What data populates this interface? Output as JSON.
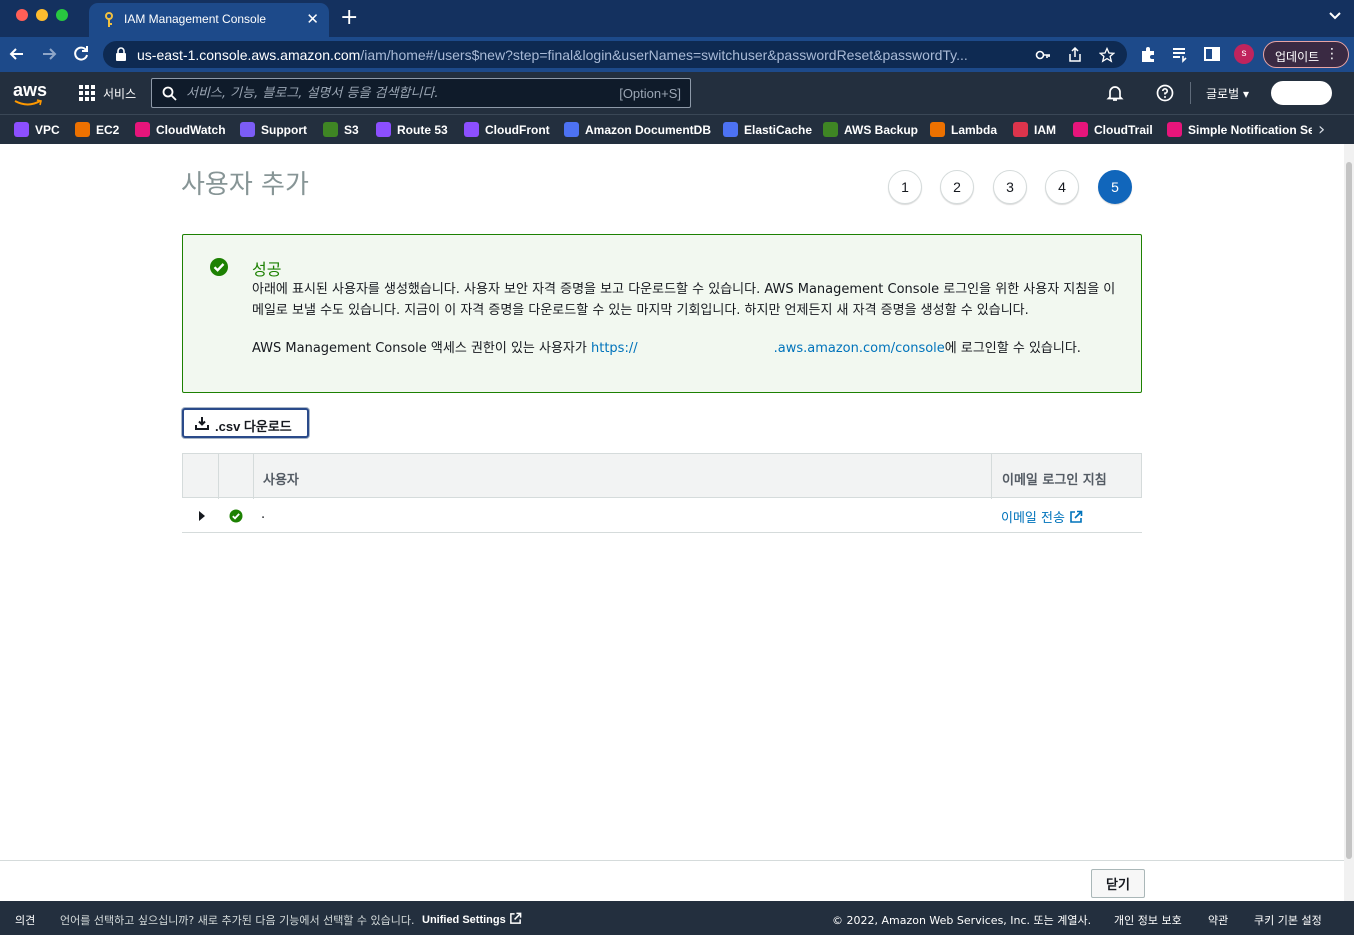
{
  "browser": {
    "tab_title": "IAM Management Console",
    "url_host": "us-east-1.console.aws.amazon.com",
    "url_path": "/iam/home#/users$new?step=final&login&userNames=switchuser&passwordReset&passwordTy...",
    "profile_initial": "s",
    "update_label": "업데이트"
  },
  "aws_header": {
    "logo": "aws",
    "services_label": "서비스",
    "search_placeholder": "서비스, 기능, 블로그, 설명서 등을 검색합니다.",
    "search_shortcut": "[Option+S]",
    "region_label": "글로벌"
  },
  "favorites": [
    {
      "label": "VPC",
      "color": "#8c4fff"
    },
    {
      "label": "EC2",
      "color": "#ed7100"
    },
    {
      "label": "CloudWatch",
      "color": "#e7157b"
    },
    {
      "label": "Support",
      "color": "#7b5cf5"
    },
    {
      "label": "S3",
      "color": "#3f8624"
    },
    {
      "label": "Route 53",
      "color": "#8c4fff"
    },
    {
      "label": "CloudFront",
      "color": "#8c4fff"
    },
    {
      "label": "Amazon DocumentDB",
      "color": "#4d72f3"
    },
    {
      "label": "ElastiCache",
      "color": "#4d72f3"
    },
    {
      "label": "AWS Backup",
      "color": "#3f8624"
    },
    {
      "label": "Lambda",
      "color": "#ed7100"
    },
    {
      "label": "IAM",
      "color": "#dd344c"
    },
    {
      "label": "CloudTrail",
      "color": "#e7157b"
    },
    {
      "label": "Simple Notification Ser",
      "color": "#e7157b"
    }
  ],
  "page": {
    "title": "사용자 추가",
    "steps": [
      "1",
      "2",
      "3",
      "4",
      "5"
    ],
    "active_step": 5
  },
  "alert": {
    "title": "성공",
    "body": "아래에 표시된 사용자를 생성했습니다. 사용자 보안 자격 증명을 보고 다운로드할 수 있습니다. AWS Management Console 로그인을 위한 사용자 지침을 이메일로 보낼 수도 있습니다. 지금이 이 자격 증명을 다운로드할 수 있는 마지막 기회입니다. 하지만 언제든지 새 자격 증명을 생성할 수 있습니다.",
    "signin_prefix": "AWS Management Console 액세스 권한이 있는 사용자가 ",
    "signin_link_start": "https://",
    "signin_link_end": ".aws.amazon.com/console",
    "signin_suffix": "에 로그인할 수 있습니다."
  },
  "csv_button": ".csv 다운로드",
  "table": {
    "headers": [
      "사용자",
      "이메일 로그인 지침"
    ],
    "rows": [
      {
        "user": ".",
        "email_action": "이메일 전송"
      }
    ]
  },
  "close_button": "닫기",
  "site_footer": {
    "feedback": "의견",
    "language_prompt": "언어를 선택하고 싶으십니까? 새로 추가된 다음 기능에서 선택할 수 있습니다.",
    "unified_settings": "Unified Settings",
    "copyright": "© 2022, Amazon Web Services, Inc. 또는 계열사.",
    "privacy": "개인 정보 보호",
    "terms": "약관",
    "cookies": "쿠키 기본 설정"
  },
  "colors": {
    "success": "#1d8102",
    "link": "#0073bb",
    "active_step": "#1166bb",
    "aws_nav": "#232f3e"
  }
}
